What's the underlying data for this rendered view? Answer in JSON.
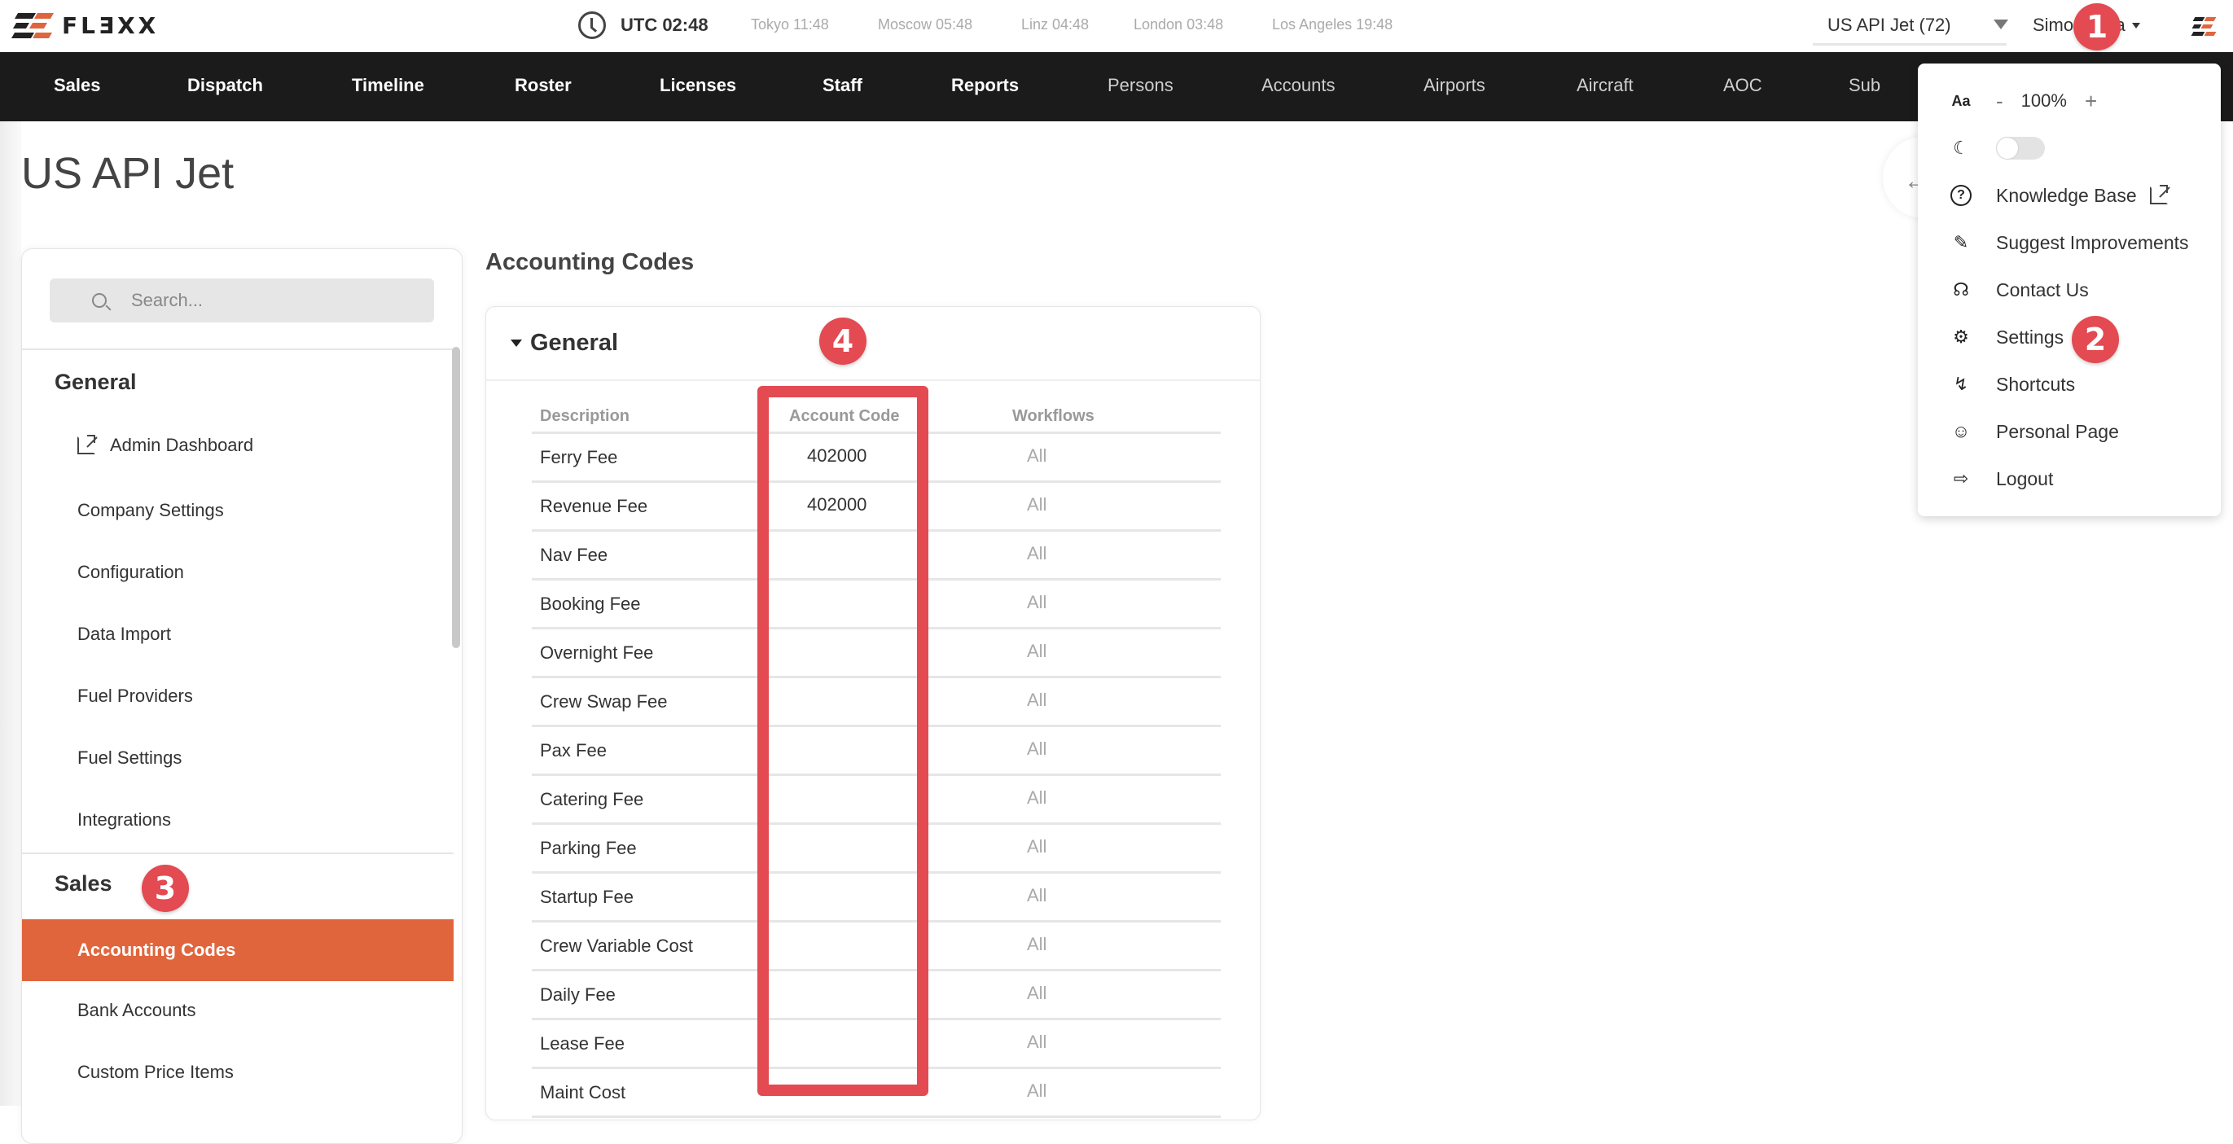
{
  "app": {
    "logo_text": "FLƎXX",
    "brand_color": "#e0653c",
    "annotation_color": "#e34a51"
  },
  "topbar": {
    "utc_time": "UTC 02:48",
    "timezones": [
      {
        "label": "Tokyo 11:48"
      },
      {
        "label": "Moscow 05:48"
      },
      {
        "label": "Linz 04:48"
      },
      {
        "label": "London 03:48"
      },
      {
        "label": "Los Angeles 19:48"
      }
    ],
    "company_select": "US API Jet (72)",
    "user_name": "Simon Riha"
  },
  "nav": {
    "items": [
      {
        "label": "Sales"
      },
      {
        "label": "Dispatch"
      },
      {
        "label": "Timeline"
      },
      {
        "label": "Roster"
      },
      {
        "label": "Licenses"
      },
      {
        "label": "Staff"
      },
      {
        "label": "Reports"
      },
      {
        "label": "Persons"
      },
      {
        "label": "Accounts"
      },
      {
        "label": "Airports"
      },
      {
        "label": "Aircraft"
      },
      {
        "label": "AOC"
      },
      {
        "label": "Sub"
      }
    ]
  },
  "page": {
    "title": "US API Jet"
  },
  "sidebar": {
    "search_placeholder": "Search...",
    "sections": [
      {
        "heading": "General",
        "items": [
          {
            "label": "Admin Dashboard",
            "icon": "external-link-icon"
          },
          {
            "label": "Company Settings"
          },
          {
            "label": "Configuration"
          },
          {
            "label": "Data Import"
          },
          {
            "label": "Fuel Providers"
          },
          {
            "label": "Fuel Settings"
          },
          {
            "label": "Integrations"
          }
        ]
      },
      {
        "heading": "Sales",
        "items": [
          {
            "label": "Accounting Codes",
            "active": true
          },
          {
            "label": "Bank Accounts"
          },
          {
            "label": "Custom Price Items"
          }
        ]
      }
    ]
  },
  "main": {
    "section_title": "Accounting Codes",
    "group_title": "General",
    "columns": [
      "Description",
      "Account Code",
      "Workflows"
    ],
    "rows": [
      {
        "description": "Ferry Fee",
        "account_code": "402000",
        "workflows": "All"
      },
      {
        "description": "Revenue Fee",
        "account_code": "402000",
        "workflows": "All"
      },
      {
        "description": "Nav Fee",
        "account_code": "",
        "workflows": "All"
      },
      {
        "description": "Booking Fee",
        "account_code": "",
        "workflows": "All"
      },
      {
        "description": "Overnight Fee",
        "account_code": "",
        "workflows": "All"
      },
      {
        "description": "Crew Swap Fee",
        "account_code": "",
        "workflows": "All"
      },
      {
        "description": "Pax Fee",
        "account_code": "",
        "workflows": "All"
      },
      {
        "description": "Catering Fee",
        "account_code": "",
        "workflows": "All"
      },
      {
        "description": "Parking Fee",
        "account_code": "",
        "workflows": "All"
      },
      {
        "description": "Startup Fee",
        "account_code": "",
        "workflows": "All"
      },
      {
        "description": "Crew Variable Cost",
        "account_code": "",
        "workflows": "All"
      },
      {
        "description": "Daily Fee",
        "account_code": "",
        "workflows": "All"
      },
      {
        "description": "Lease Fee",
        "account_code": "",
        "workflows": "All"
      },
      {
        "description": "Maint Cost",
        "account_code": "",
        "workflows": "All"
      }
    ]
  },
  "user_menu": {
    "zoom_level": "100%",
    "zoom_minus": "-",
    "zoom_plus": "+",
    "dark_mode": false,
    "items": [
      {
        "label": "Knowledge Base",
        "icon": "help-circle-icon",
        "external": true
      },
      {
        "label": "Suggest Improvements",
        "icon": "edit-suggest-icon"
      },
      {
        "label": "Contact Us",
        "icon": "headset-icon"
      },
      {
        "label": "Settings",
        "icon": "gear-icon"
      },
      {
        "label": "Shortcuts",
        "icon": "lightning-icon"
      },
      {
        "label": "Personal Page",
        "icon": "user-icon"
      },
      {
        "label": "Logout",
        "icon": "logout-icon"
      }
    ]
  },
  "annotations": {
    "badges": [
      "1",
      "2",
      "3",
      "4"
    ]
  }
}
